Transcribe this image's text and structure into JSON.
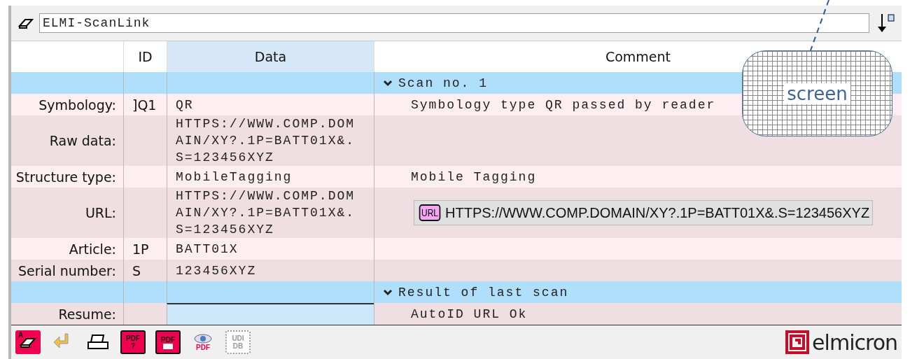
{
  "title_field": {
    "value": "ELMI-ScanLink"
  },
  "table": {
    "columns": [
      "ID",
      "Data",
      "Comment"
    ],
    "rows": [
      {
        "kind": "section",
        "comment": "Scan no. 1"
      },
      {
        "kind": "field",
        "label": "Symbology:",
        "id": "]Q1",
        "data": "QR",
        "comment": "Symbology type QR passed by reader"
      },
      {
        "kind": "field",
        "label": "Raw data:",
        "data": "HTTPS://WWW.COMP.DOMAIN/XY?.1P=BATT01X&.S=123456XYZ"
      },
      {
        "kind": "field",
        "label": "Structure type:",
        "data": "MobileTagging",
        "comment": "Mobile Tagging"
      },
      {
        "kind": "url",
        "label": "URL:",
        "data": "HTTPS://WWW.COMP.DOMAIN/XY?.1P=BATT01X&.S=123456XYZ",
        "badge": "URL",
        "link": "HTTPS://WWW.COMP.DOMAIN/XY?.1P=BATT01X&.S=123456XYZ"
      },
      {
        "kind": "field",
        "label": "Article:",
        "id": "1P",
        "data": "BATT01X"
      },
      {
        "kind": "field",
        "label": "Serial number:",
        "id": "S",
        "data": "123456XYZ"
      },
      {
        "kind": "section",
        "comment": "Result of last scan"
      },
      {
        "kind": "field",
        "label": "Resume:",
        "comment": "AutoID URL Ok",
        "selected": true
      }
    ]
  },
  "toolbar": [
    {
      "kind": "eraser",
      "label": "A"
    },
    {
      "kind": "arrow"
    },
    {
      "kind": "printer"
    },
    {
      "kind": "pdf",
      "label": "PDF",
      "sub": "?"
    },
    {
      "kind": "pdf",
      "label": "PDF"
    },
    {
      "kind": "eye",
      "label": "PDF"
    },
    {
      "kind": "udi",
      "label": "UDI",
      "sub": "DB"
    }
  ],
  "logo": {
    "text": "elmicron"
  },
  "callout": {
    "text": "screen"
  }
}
